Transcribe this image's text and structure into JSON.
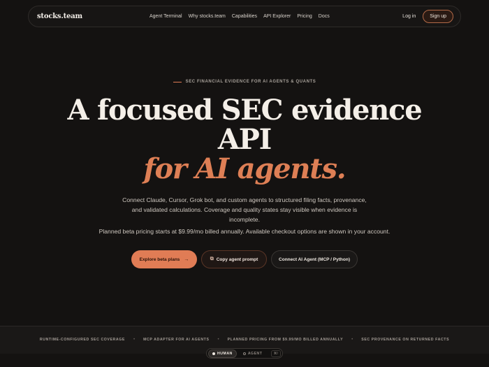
{
  "nav": {
    "logo": "stocks.team",
    "links": [
      "Agent Terminal",
      "Why stocks.team",
      "Capabilities",
      "API Explorer",
      "Pricing",
      "Docs"
    ],
    "login": "Log in",
    "signup": "Sign up"
  },
  "hero": {
    "eyebrow": "SEC FINANCIAL EVIDENCE FOR AI AGENTS & QUANTS",
    "title_line1": "A focused SEC evidence",
    "title_line2": "API",
    "title_line3": "for AI agents.",
    "subtitle": "Connect Claude, Cursor, Grok bot, and custom agents to structured filing facts, provenance, and validated calculations. Coverage and quality states stay visible when evidence is incomplete.",
    "pricing": "Planned beta pricing starts at $9.99/mo billed annually. Available checkout options are shown in your account.",
    "buttons": {
      "explore": "Explore beta plans",
      "explore_arrow": "→",
      "copy": "Copy agent prompt",
      "copy_icon": "⧉",
      "connect": "Connect AI Agent (MCP / Python)"
    }
  },
  "strip": {
    "items": [
      "RUNTIME-CONFIGURED SEC COVERAGE",
      "MCP ADAPTER FOR AI AGENTS",
      "PLANNED PRICING FROM $9.99/MO BILLED ANNUALLY",
      "SEC PROVENANCE ON RETURNED FACTS"
    ],
    "separator": "•"
  },
  "mode_toggle": {
    "human": "HUMAN",
    "agent": "AGENT",
    "shortcut": "⌘/"
  },
  "colors": {
    "accent": "#e07c55",
    "background": "#141211"
  }
}
